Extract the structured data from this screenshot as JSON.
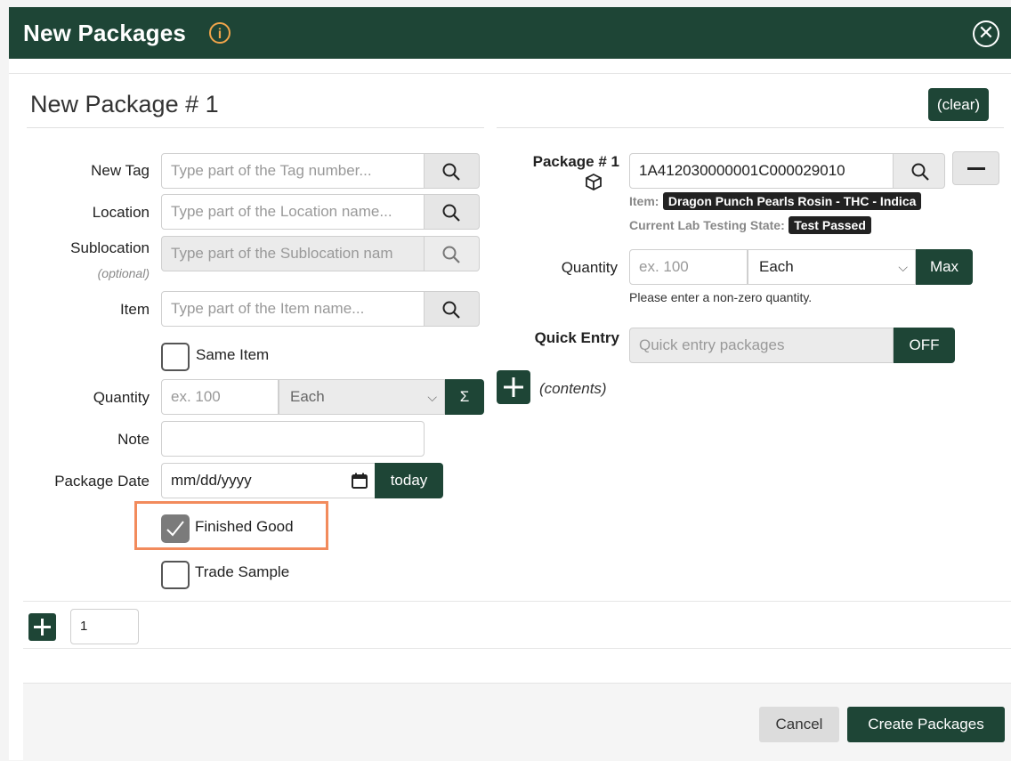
{
  "dialog": {
    "title": "New Packages",
    "info_icon": "info-icon",
    "close_icon": "close-circle-icon"
  },
  "package": {
    "title": "New Package # 1",
    "clear_label": "(clear)"
  },
  "form": {
    "new_tag": {
      "label": "New Tag",
      "placeholder": "Type part of the Tag number..."
    },
    "location": {
      "label": "Location",
      "placeholder": "Type part of the Location name..."
    },
    "sublocation": {
      "label": "Sublocation",
      "hint": "(optional)",
      "placeholder": "Type part of the Sublocation nam"
    },
    "item": {
      "label": "Item",
      "placeholder": "Type part of the Item name..."
    },
    "same_item": {
      "label": "Same Item",
      "checked": false
    },
    "quantity": {
      "label": "Quantity",
      "placeholder": "ex. 100",
      "unit": "Each",
      "sum_label": "Σ"
    },
    "note": {
      "label": "Note",
      "value": ""
    },
    "package_date": {
      "label": "Package Date",
      "placeholder": "mm/dd/yyyy",
      "today_label": "today"
    },
    "finished_good": {
      "label": "Finished Good",
      "checked": true
    },
    "trade_sample": {
      "label": "Trade Sample",
      "checked": false
    }
  },
  "source": {
    "label": "Package # 1",
    "tag_value": "1A412030000001C000029010",
    "item_label": "Item:",
    "item_value": "Dragon Punch Pearls Rosin - THC - Indica",
    "lab_label": "Current Lab Testing State:",
    "lab_value": "Test Passed",
    "quantity_label": "Quantity",
    "quantity_placeholder": "ex. 100",
    "unit": "Each",
    "max_label": "Max",
    "quantity_hint": "Please enter a non-zero quantity.",
    "quick_entry_label": "Quick Entry",
    "quick_entry_placeholder": "Quick entry packages",
    "quick_entry_toggle": "OFF",
    "contents_label": "(contents)"
  },
  "add_bar": {
    "count_value": "1"
  },
  "footer": {
    "cancel_label": "Cancel",
    "create_label": "Create Packages"
  },
  "colors": {
    "brand_dark_green": "#1e4536",
    "highlight_orange": "#f28b5c",
    "info_orange": "#f0a44a"
  }
}
